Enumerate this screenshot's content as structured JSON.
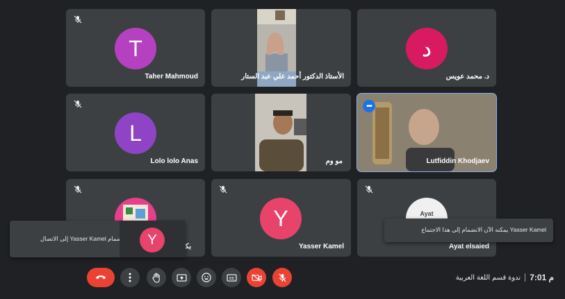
{
  "participants": [
    {
      "name": "Taher Mahmoud",
      "initial": "T",
      "color": "#b541c0"
    },
    {
      "name": "الأستاذ الدكتور أحمد علي عبد الستار",
      "video": true
    },
    {
      "name": "د. محمد عويس",
      "initial": "د",
      "color": "#d81b60"
    },
    {
      "name": "Lolo lolo Anas",
      "initial": "L",
      "color": "#8e44c4"
    },
    {
      "name": "مو وم",
      "video": true
    },
    {
      "name": "Lutfiddin Khodjaev",
      "video": true,
      "active": true
    },
    {
      "name": "بكر ح",
      "partial": true
    },
    {
      "name": "Yasser Kamel",
      "initial": "Y",
      "color": "#e8436b"
    },
    {
      "name": "Ayat elsaied",
      "logo_text": "Ayat"
    }
  ],
  "toast_left": {
    "text": "انضمام Yasser Kamel إلى الاتصال",
    "initial": "Y",
    "color": "#e8436b"
  },
  "toast_right": {
    "text": "Yasser Kamel يمكنه الآن الانضمام إلى هذا الاجتماع"
  },
  "meeting": {
    "time": "7:01 م",
    "title": "ندوة قسم اللغة العربية"
  },
  "controls": [
    "end-call-icon",
    "more-options-icon",
    "raise-hand-icon",
    "present-screen-icon",
    "emoji-icon",
    "captions-icon",
    "camera-off-icon",
    "mic-off-icon"
  ],
  "colors": {
    "background": "#202124",
    "tile": "#3c4043",
    "active_border": "#8ab4f8",
    "danger": "#ea4335"
  }
}
